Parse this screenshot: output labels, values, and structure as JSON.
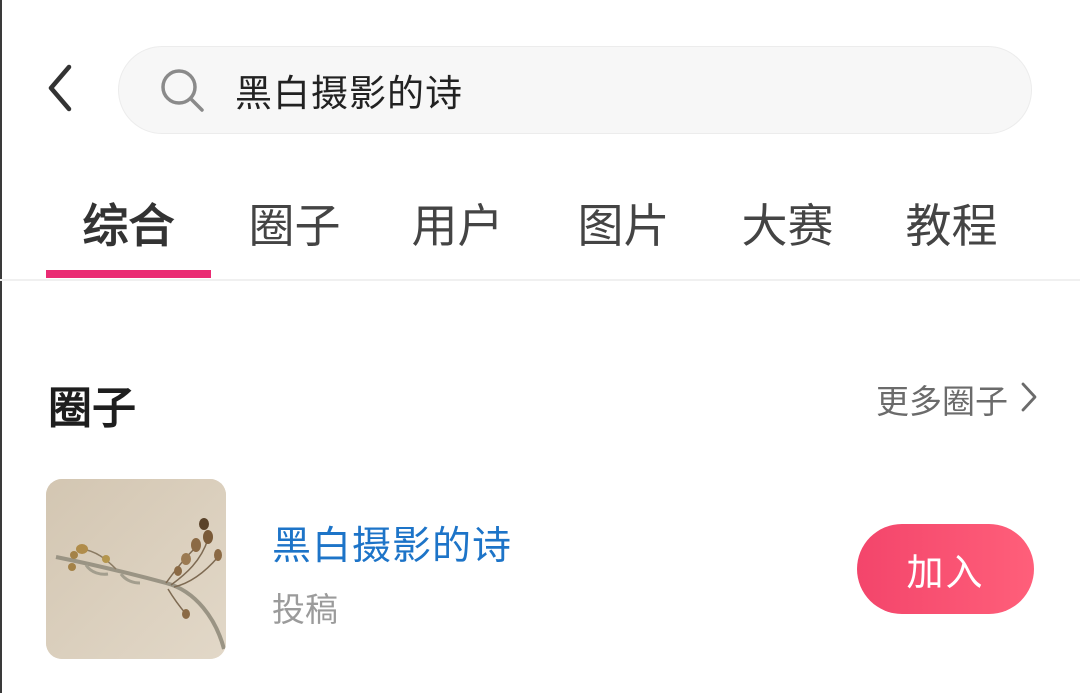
{
  "header": {
    "back_icon": "chevron-left-icon",
    "search_icon": "search-icon",
    "search_query": "黑白摄影的诗"
  },
  "tabs": [
    {
      "label": "综合",
      "active": true
    },
    {
      "label": "圈子",
      "active": false
    },
    {
      "label": "用户",
      "active": false
    },
    {
      "label": "图片",
      "active": false
    },
    {
      "label": "大赛",
      "active": false
    },
    {
      "label": "教程",
      "active": false
    }
  ],
  "colors": {
    "accent": "#ea2b73",
    "link": "#1d74c8",
    "join_button": "#f64b6e"
  },
  "circles_section": {
    "title": "圈子",
    "more_label": "更多圈子",
    "more_icon": "chevron-right-icon"
  },
  "circle_card": {
    "name": "黑白摄影的诗",
    "subtitle": "投稿",
    "join_label": "加入",
    "thumbnail": "dried-plant-photo"
  }
}
